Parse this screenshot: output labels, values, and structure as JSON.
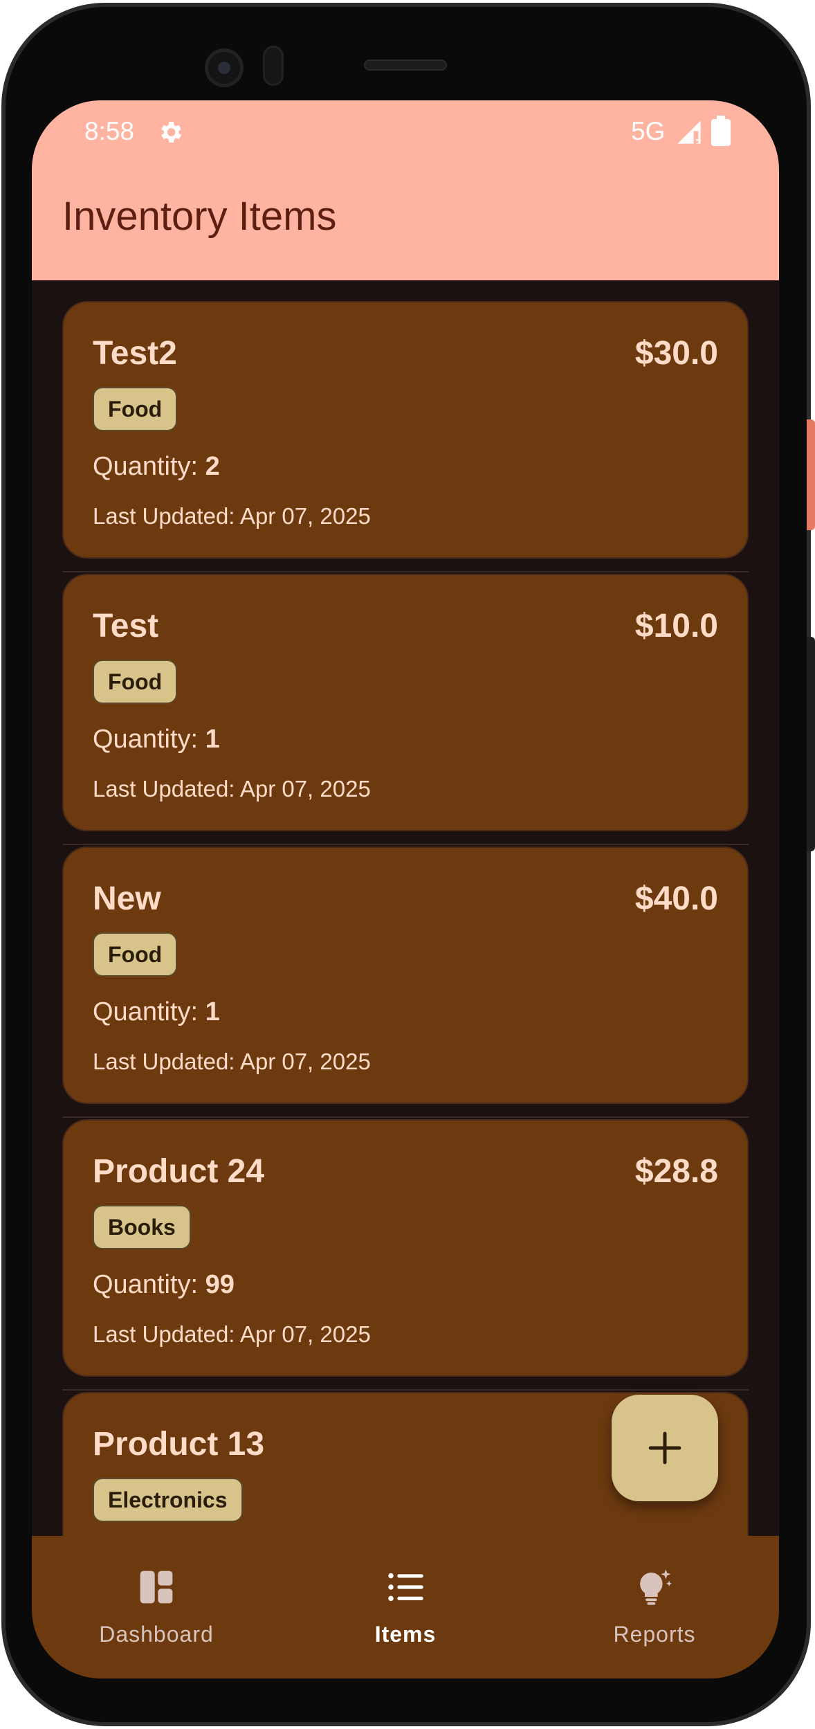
{
  "status_bar": {
    "time": "8:58",
    "network": "5G"
  },
  "app_bar": {
    "title": "Inventory Items"
  },
  "items": [
    {
      "name": "Test2",
      "price": "$30.0",
      "category": "Food",
      "quantity_label": "Quantity: ",
      "quantity": "2",
      "updated_label": "Last Updated: ",
      "updated": "Apr 07, 2025"
    },
    {
      "name": "Test",
      "price": "$10.0",
      "category": "Food",
      "quantity_label": "Quantity: ",
      "quantity": "1",
      "updated_label": "Last Updated: ",
      "updated": "Apr 07, 2025"
    },
    {
      "name": "New",
      "price": "$40.0",
      "category": "Food",
      "quantity_label": "Quantity: ",
      "quantity": "1",
      "updated_label": "Last Updated: ",
      "updated": "Apr 07, 2025"
    },
    {
      "name": "Product 24",
      "price": "$28.8",
      "category": "Books",
      "quantity_label": "Quantity: ",
      "quantity": "99",
      "updated_label": "Last Updated: ",
      "updated": "Apr 07, 2025"
    },
    {
      "name": "Product 13",
      "category": "Electronics"
    }
  ],
  "fab": {
    "icon": "plus-icon"
  },
  "bottom_nav": [
    {
      "label": "Dashboard",
      "icon": "dashboard-icon",
      "active": false
    },
    {
      "label": "Items",
      "icon": "list-icon",
      "active": true
    },
    {
      "label": "Reports",
      "icon": "lightbulb-sparkle-icon",
      "active": false
    }
  ],
  "colors": {
    "app_bar": "#ffb4a2",
    "card": "#6d3a10",
    "chip": "#d8c48a",
    "background": "#1b1110",
    "text_on_card": "#ffdbc8"
  }
}
